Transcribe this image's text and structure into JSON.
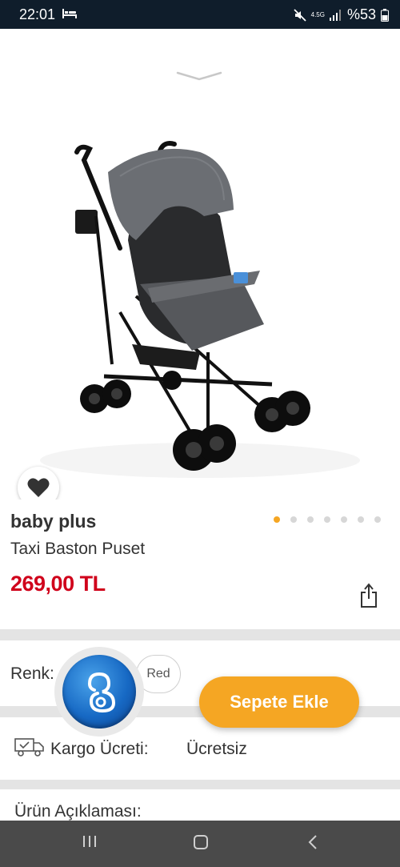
{
  "status_bar": {
    "time": "22:01",
    "network_top": "4.5G",
    "battery": "%53"
  },
  "product": {
    "brand": "baby plus",
    "name": "Taxi Baston Puset",
    "price": "269,00 TL",
    "image_count": 7,
    "active_image": 1
  },
  "options": {
    "color_label": "Renk:",
    "selected_color": "Red"
  },
  "actions": {
    "add_to_cart": "Sepete Ekle"
  },
  "shipping": {
    "label": "Kargo Ücreti:",
    "value": "Ücretsiz"
  },
  "description": {
    "label": "Ürün Açıklaması:"
  },
  "colors": {
    "accent": "#f5a623",
    "price": "#d0021b",
    "status_bar": "#0f1d2b",
    "nav_bar": "#4a4a4a"
  },
  "icons": {
    "favorite": "heart-icon",
    "share": "share-icon",
    "shipping": "truck-icon",
    "collapse": "chevron-down-icon",
    "nav_recents": "recents-icon",
    "nav_home": "home-icon",
    "nav_back": "back-icon"
  }
}
